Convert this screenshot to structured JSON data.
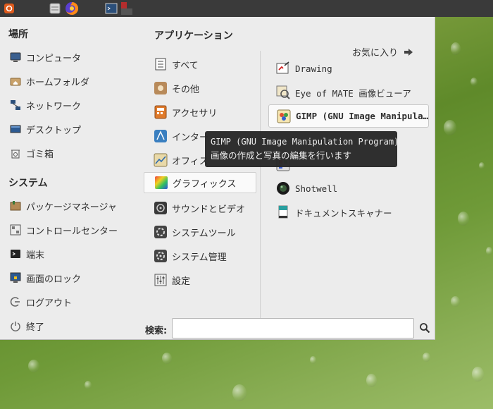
{
  "places": {
    "heading": "場所",
    "items": [
      {
        "label": "コンピュータ",
        "icon": "computer-icon"
      },
      {
        "label": "ホームフォルダ",
        "icon": "home-folder-icon"
      },
      {
        "label": "ネットワーク",
        "icon": "network-icon"
      },
      {
        "label": "デスクトップ",
        "icon": "desktop-icon"
      },
      {
        "label": "ゴミ箱",
        "icon": "trash-icon"
      }
    ]
  },
  "system": {
    "heading": "システム",
    "items": [
      {
        "label": "パッケージマネージャ",
        "icon": "package-manager-icon"
      },
      {
        "label": "コントロールセンター",
        "icon": "control-center-icon"
      },
      {
        "label": "端末",
        "icon": "terminal-icon"
      },
      {
        "label": "画面のロック",
        "icon": "lock-screen-icon"
      },
      {
        "label": "ログアウト",
        "icon": "logout-icon"
      },
      {
        "label": "終了",
        "icon": "power-icon"
      }
    ]
  },
  "applications": {
    "heading": "アプリケーション",
    "favorites_label": "お気に入り",
    "categories": [
      {
        "label": "すべて",
        "icon": "all-icon"
      },
      {
        "label": "その他",
        "icon": "other-icon"
      },
      {
        "label": "アクセサリ",
        "icon": "accessories-icon"
      },
      {
        "label": "インター",
        "icon": "internet-icon"
      },
      {
        "label": "オフィス",
        "icon": "office-icon"
      },
      {
        "label": "グラフィックス",
        "icon": "graphics-icon",
        "selected": true
      },
      {
        "label": "サウンドとビデオ",
        "icon": "sound-video-icon"
      },
      {
        "label": "システムツール",
        "icon": "system-tools-icon"
      },
      {
        "label": "システム管理",
        "icon": "administration-icon"
      },
      {
        "label": "設定",
        "icon": "settings-icon"
      }
    ],
    "apps": [
      {
        "label": "Drawing",
        "icon": "drawing-icon"
      },
      {
        "label": "Eye of MATE 画像ビューア",
        "icon": "image-viewer-icon"
      },
      {
        "label": "GIMP (GNU Image Manipula…",
        "icon": "gimp-icon",
        "highlighted": true
      },
      {
        "label": "",
        "icon": "color-picker-icon"
      },
      {
        "label": "Shotwell",
        "icon": "shotwell-icon"
      },
      {
        "label": "ドキュメントスキャナー",
        "icon": "scanner-icon"
      }
    ]
  },
  "search": {
    "label": "検索:",
    "value": "",
    "placeholder": ""
  },
  "tooltip": {
    "line1": "GIMP (GNU Image Manipulation Program)",
    "line2": "画像の作成と写真の編集を行います"
  },
  "colors": {
    "menu_bg": "#ececec",
    "panel_bg": "#3a3a3a",
    "tooltip_bg": "#282828",
    "desktop": "#6f9a38"
  }
}
